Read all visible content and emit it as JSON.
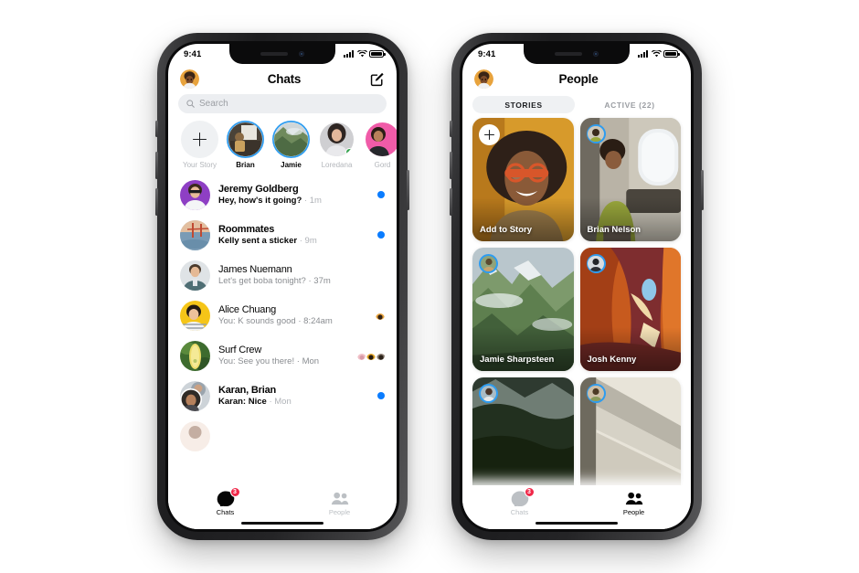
{
  "page": {
    "background": "#ffffff"
  },
  "colors": {
    "accent_blue": "#0a7cff",
    "ring_blue": "#2d9cf0",
    "badge_red": "#f02849",
    "online_green": "#31a24c",
    "text_primary": "#050505",
    "text_secondary": "#8a8d91",
    "text_muted": "#bcc0c4",
    "field_bg": "#eceef1"
  },
  "phone_chats": {
    "status_bar": {
      "time": "9:41",
      "signal_icon": "cellular-bars-icon",
      "wifi_icon": "wifi-icon",
      "battery_icon": "battery-icon"
    },
    "header": {
      "avatar": "profile-avatar",
      "title": "Chats",
      "compose_icon": "compose-pencil-icon"
    },
    "search": {
      "icon": "search-icon",
      "placeholder": "Search",
      "value": ""
    },
    "stories": [
      {
        "name": "Your Story",
        "type": "add",
        "ring": false,
        "online": false,
        "muted": true
      },
      {
        "name": "Brian",
        "type": "photo",
        "ring": true,
        "online": false,
        "muted": false
      },
      {
        "name": "Jamie",
        "type": "photo",
        "ring": true,
        "online": false,
        "muted": false
      },
      {
        "name": "Loredana",
        "type": "photo",
        "ring": false,
        "online": true,
        "muted": true
      },
      {
        "name": "Gord",
        "type": "photo",
        "ring": false,
        "online": false,
        "muted": true
      }
    ],
    "chats": [
      {
        "name": "Jeremy Goldberg",
        "preview": "Hey, how's it going?",
        "time": "1m",
        "unread": true,
        "indicator": "unread-dot"
      },
      {
        "name": "Roommates",
        "preview": "Kelly sent a sticker",
        "time": "9m",
        "unread": true,
        "indicator": "unread-dot"
      },
      {
        "name": "James Nuemann",
        "preview": "Let's get boba tonight?",
        "time": "37m",
        "unread": false,
        "indicator": "none"
      },
      {
        "name": "Alice Chuang",
        "preview": "You: K sounds good",
        "time": "8:24am",
        "unread": false,
        "indicator": "seen-avatars"
      },
      {
        "name": "Surf Crew",
        "preview": "You: See you there!",
        "time": "Mon",
        "unread": false,
        "indicator": "seen-avatars"
      },
      {
        "name": "Karan, Brian",
        "sender": "Karan:",
        "preview": "Nice",
        "time": "Mon",
        "unread": true,
        "indicator": "unread-dot"
      }
    ],
    "tabs": [
      {
        "label": "Chats",
        "icon": "chat-bubble-icon",
        "active": true,
        "badge": "3"
      },
      {
        "label": "People",
        "icon": "people-icon",
        "active": false,
        "badge": ""
      }
    ]
  },
  "phone_people": {
    "status_bar": {
      "time": "9:41",
      "signal_icon": "cellular-bars-icon",
      "wifi_icon": "wifi-icon",
      "battery_icon": "battery-icon"
    },
    "header": {
      "avatar": "profile-avatar",
      "title": "People"
    },
    "segments": [
      {
        "label": "STORIES",
        "active": true
      },
      {
        "label": "ACTIVE (22)",
        "active": false
      }
    ],
    "story_cards": [
      {
        "label": "Add to Story",
        "kind": "add",
        "scene": "portrait-yellow"
      },
      {
        "label": "Brian Nelson",
        "kind": "story",
        "scene": "airplane-window"
      },
      {
        "label": "Jamie Sharpsteen",
        "kind": "story",
        "scene": "green-mountain"
      },
      {
        "label": "Josh Kenny",
        "kind": "story",
        "scene": "orange-canyon"
      },
      {
        "label": "",
        "kind": "story",
        "scene": "dark-forest"
      },
      {
        "label": "",
        "kind": "story",
        "scene": "house-eaves"
      }
    ],
    "tabs": [
      {
        "label": "Chats",
        "icon": "chat-bubble-icon",
        "active": false,
        "badge": "3"
      },
      {
        "label": "People",
        "icon": "people-icon",
        "active": true,
        "badge": ""
      }
    ]
  }
}
